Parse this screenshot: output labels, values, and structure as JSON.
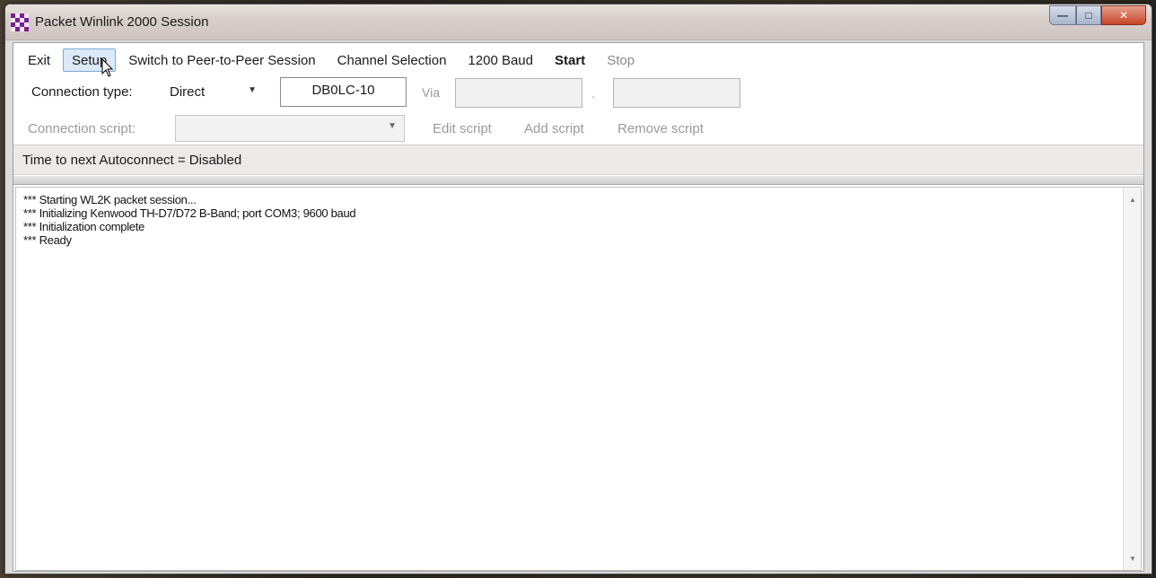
{
  "window": {
    "title": "Packet Winlink 2000 Session"
  },
  "menu": {
    "exit": "Exit",
    "setup": "Setup",
    "switch_session": "Switch to Peer-to-Peer Session",
    "channel_selection": "Channel Selection",
    "baud": "1200 Baud",
    "start": "Start",
    "stop": "Stop"
  },
  "connection": {
    "type_label": "Connection type:",
    "type_value": "Direct",
    "callsign": "DB0LC-10",
    "via_label": "Via",
    "via_value_1": "",
    "via_separator": ".",
    "via_value_2": ""
  },
  "script": {
    "label": "Connection script:",
    "value": "",
    "edit": "Edit script",
    "add": "Add script",
    "remove": "Remove script"
  },
  "status": {
    "autoconnect": "Time to next Autoconnect = Disabled"
  },
  "log": {
    "lines": [
      "*** Starting WL2K packet session...",
      "*** Initializing Kenwood TH-D7/D72 B-Band; port COM3; 9600 baud",
      "*** Initialization complete",
      "*** Ready"
    ]
  },
  "icons": {
    "app": "checkered-grid-icon",
    "minimize": "minimize-icon",
    "maximize": "maximize-icon",
    "close": "close-icon"
  },
  "colors": {
    "menu_hover_bg": "#dbe9f8",
    "menu_hover_border": "#7ea8d8",
    "close_button": "#c8452a",
    "app_icon_purple": "#7b1f8f"
  }
}
